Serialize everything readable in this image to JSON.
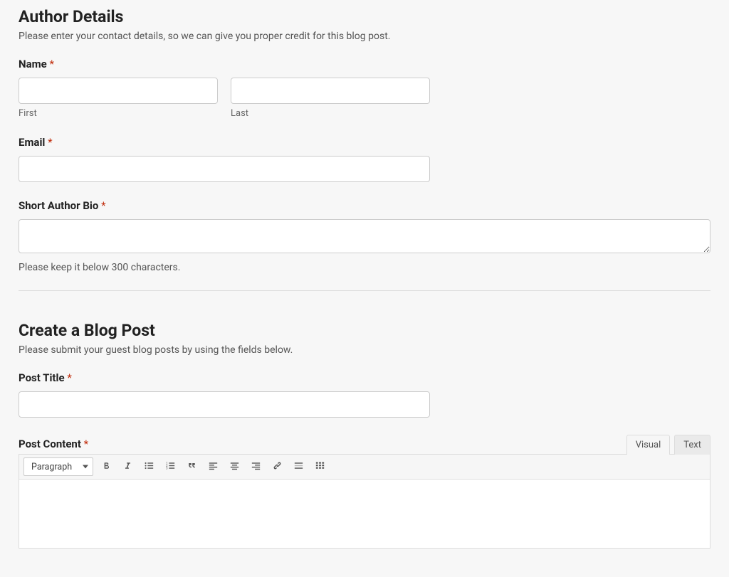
{
  "authorSection": {
    "title": "Author Details",
    "description": "Please enter your contact details, so we can give you proper credit for this blog post."
  },
  "nameField": {
    "label": "Name",
    "required": "*",
    "firstSub": "First",
    "lastSub": "Last"
  },
  "emailField": {
    "label": "Email",
    "required": "*"
  },
  "bioField": {
    "label": "Short Author Bio",
    "required": "*",
    "helper": "Please keep it below 300 characters."
  },
  "postSection": {
    "title": "Create a Blog Post",
    "description": "Please submit your guest blog posts by using the fields below."
  },
  "titleField": {
    "label": "Post Title",
    "required": "*"
  },
  "contentField": {
    "label": "Post Content",
    "required": "*"
  },
  "editorTabs": {
    "visual": "Visual",
    "text": "Text"
  },
  "formatSelect": {
    "selected": "Paragraph"
  }
}
